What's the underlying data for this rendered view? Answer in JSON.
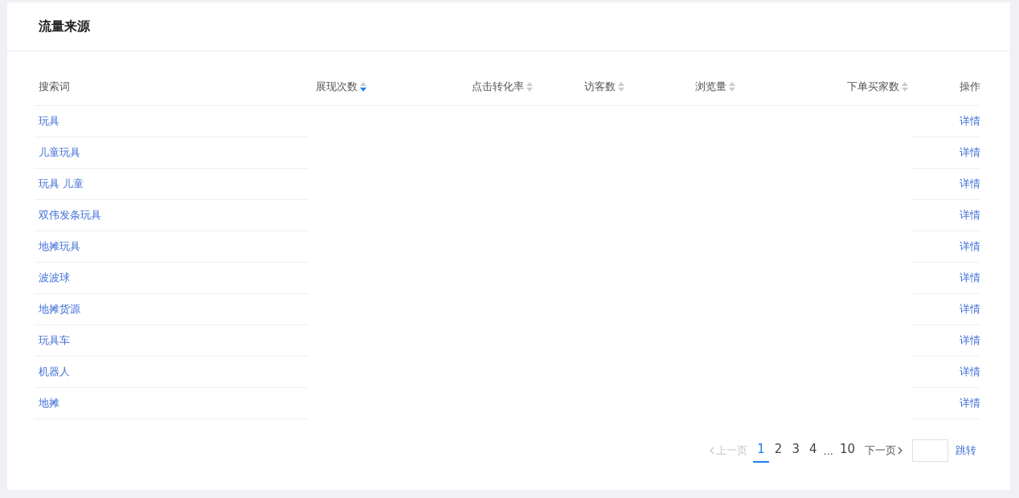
{
  "card": {
    "title": "流量来源"
  },
  "table": {
    "columns": [
      {
        "label": "搜索词"
      },
      {
        "label": "展现次数",
        "sorted_desc": true
      },
      {
        "label": "点击转化率",
        "sorted_desc": false
      },
      {
        "label": "访客数",
        "sorted_desc": false
      },
      {
        "label": "浏览量",
        "sorted_desc": false
      },
      {
        "label": "下单买家数",
        "sorted_desc": false
      },
      {
        "label": "操作"
      }
    ],
    "rows": [
      {
        "keyword": "玩具",
        "action": "详情"
      },
      {
        "keyword": "儿童玩具",
        "action": "详情"
      },
      {
        "keyword": "玩具 儿童",
        "action": "详情"
      },
      {
        "keyword": "双伟发条玩具",
        "action": "详情"
      },
      {
        "keyword": "地摊玩具",
        "action": "详情"
      },
      {
        "keyword": "波波球",
        "action": "详情"
      },
      {
        "keyword": "地摊货源",
        "action": "详情"
      },
      {
        "keyword": "玩具车",
        "action": "详情"
      },
      {
        "keyword": "机器人",
        "action": "详情"
      },
      {
        "keyword": "地摊",
        "action": "详情"
      }
    ]
  },
  "pagination": {
    "prev": {
      "label": "上一页",
      "disabled": true
    },
    "pages": [
      {
        "kind": "page",
        "label": "1",
        "selected": true
      },
      {
        "kind": "page",
        "label": "2",
        "selected": false
      },
      {
        "kind": "page",
        "label": "3",
        "selected": false
      },
      {
        "kind": "page",
        "label": "4",
        "selected": false
      },
      {
        "kind": "ellipsis",
        "label": "..."
      },
      {
        "kind": "page",
        "label": "10",
        "selected": false
      }
    ],
    "next": {
      "label": "下一页",
      "disabled": false
    },
    "jump": {
      "label": "跳转"
    }
  }
}
